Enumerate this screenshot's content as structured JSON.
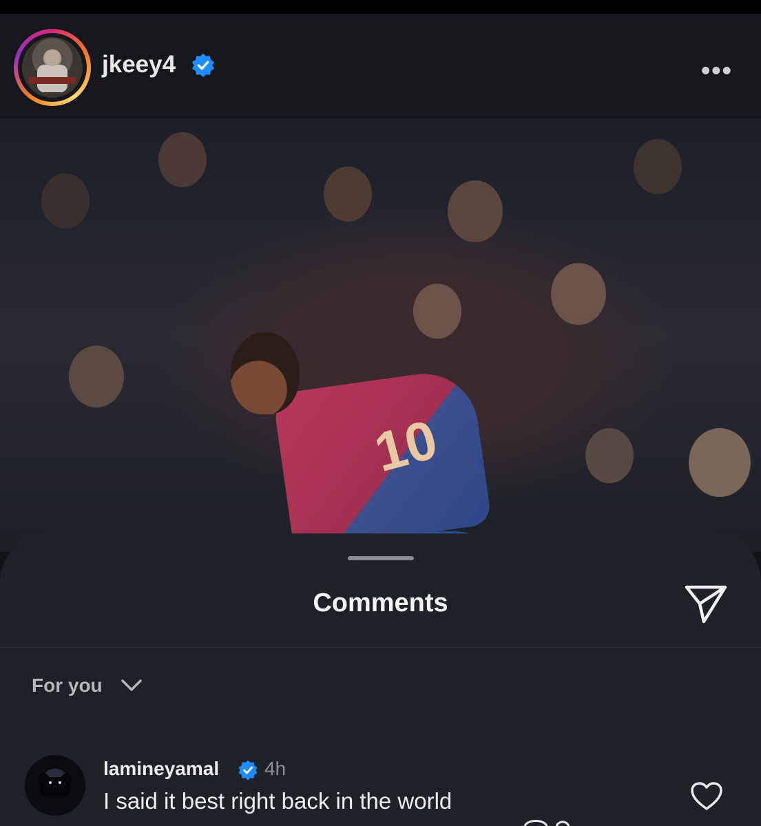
{
  "post": {
    "username": "jkeey4",
    "more_menu": "•••"
  },
  "photo": {
    "jersey_number": "10"
  },
  "comments_sheet": {
    "title": "Comments",
    "filter_label": "For you",
    "comments": [
      {
        "username": "lamineyamal",
        "time": "4h",
        "text": "I said it best right back in the world"
      }
    ]
  },
  "colors": {
    "verified_blue": "#1f8cff",
    "sheet_bg": "#1f2128",
    "header_bg": "#15171c"
  },
  "icons": {
    "verified": "verified-badge-icon",
    "more": "more-dots-icon",
    "share": "send-icon",
    "chevron": "chevron-down-icon",
    "like": "heart-icon"
  }
}
